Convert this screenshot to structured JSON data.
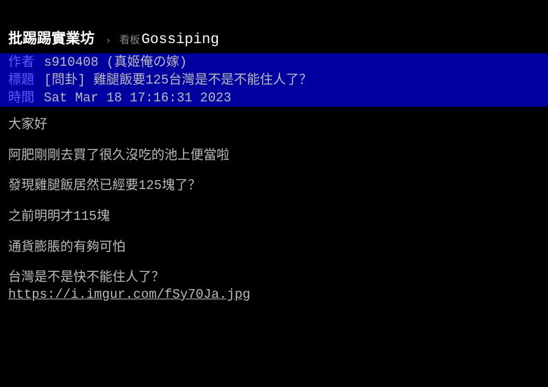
{
  "header": {
    "site_name": "批踢踢實業坊",
    "arrow": "›",
    "board_label": "看板",
    "board_name": "Gossiping"
  },
  "meta": {
    "author_label": "作者",
    "author_value": "s910408 (真姬俺の嫁)",
    "title_label": "標題",
    "title_value": "[問卦] 雞腿飯要125台灣是不是不能住人了？",
    "time_label": "時間",
    "time_value": "Sat Mar 18 17:16:31 2023"
  },
  "content": {
    "p1": "大家好",
    "p2": "阿肥剛剛去買了很久沒吃的池上便當啦",
    "p3": "發現雞腿飯居然已經要125塊了？",
    "p4": "之前明明才115塊",
    "p5": "通貨膨脹的有夠可怕",
    "p6": "台灣是不是快不能住人了？",
    "link": "https://i.imgur.com/fSy70Ja.jpg"
  }
}
